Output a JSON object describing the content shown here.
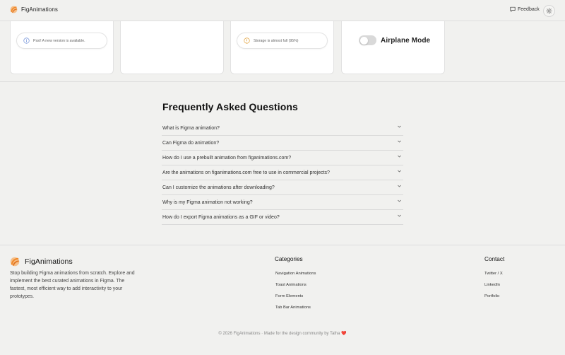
{
  "header": {
    "brand_name": "FigAnimations",
    "feedback_label": "Feedback",
    "logo_icon": "figanimations-logo-icon",
    "theme_icon": "sun-icon"
  },
  "cards": {
    "toast_update": {
      "text": "Psst! A new version is available.",
      "icon": "info-icon",
      "icon_color": "#6f8fd8"
    },
    "toast_storage": {
      "text": "Storage is almost full (95%)",
      "icon": "warning-icon",
      "icon_color": "#e2a13a"
    },
    "airplane": {
      "label": "Airplane Mode",
      "enabled": false
    }
  },
  "faq": {
    "title": "Frequently Asked Questions",
    "items": [
      "What is Figma animation?",
      "Can Figma do animation?",
      "How do I use a prebuilt animation from figanimations.com?",
      "Are the animations on figanimations.com free to use in commercial projects?",
      "Can I customize the animations after downloading?",
      "Why is my Figma animation not working?",
      "How do I export Figma animations as a GIF or video?"
    ]
  },
  "footer": {
    "brand_name": "FigAnimations",
    "description": "Stop building Figma animations from scratch. Explore and implement the best curated animations in Figma. The fastest, most efficient way to add interactivity to your prototypes.",
    "categories_title": "Categories",
    "categories": [
      "Navigation Animations",
      "Toast Animations",
      "Form Elements",
      "Tab Bar Animations"
    ],
    "contact_title": "Contact",
    "contact": [
      "Twitter / X",
      "LinkedIn",
      "Portfolio"
    ],
    "copyright": "© 2026 FigAnimations · Made for the design community by Talha",
    "heart": "❤️"
  },
  "colors": {
    "background": "#f1f1ef",
    "card": "#ffffff",
    "logo_orange": "#f08a2c",
    "accent_warning": "#e2a13a",
    "accent_info": "#6f8fd8"
  }
}
